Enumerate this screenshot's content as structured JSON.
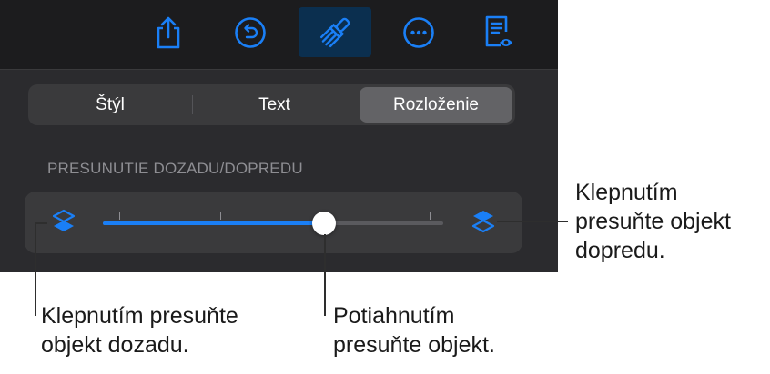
{
  "toolbar": {
    "buttons": [
      {
        "icon": "share-icon"
      },
      {
        "icon": "undo-icon"
      },
      {
        "icon": "paintbrush-icon",
        "active": true
      },
      {
        "icon": "more-icon"
      },
      {
        "icon": "reading-view-icon"
      }
    ],
    "accent_color": "#1a7ff6"
  },
  "tabs": {
    "style_label": "Štýl",
    "text_label": "Text",
    "layout_label": "Rozloženie",
    "selected": "Rozloženie"
  },
  "arrange": {
    "section_label": "PRESUNUTIE DOZADU/DOPREDU",
    "slider_value": 0.65,
    "back_icon": "layers-back-icon",
    "forward_icon": "layers-forward-icon"
  },
  "callouts": {
    "forward": [
      "Klepnutím",
      "presuňte objekt",
      "dopredu."
    ],
    "back": [
      "Klepnutím presuňte",
      "objekt dozadu."
    ],
    "drag": [
      "Potiahnutím",
      "presuňte objekt."
    ]
  }
}
